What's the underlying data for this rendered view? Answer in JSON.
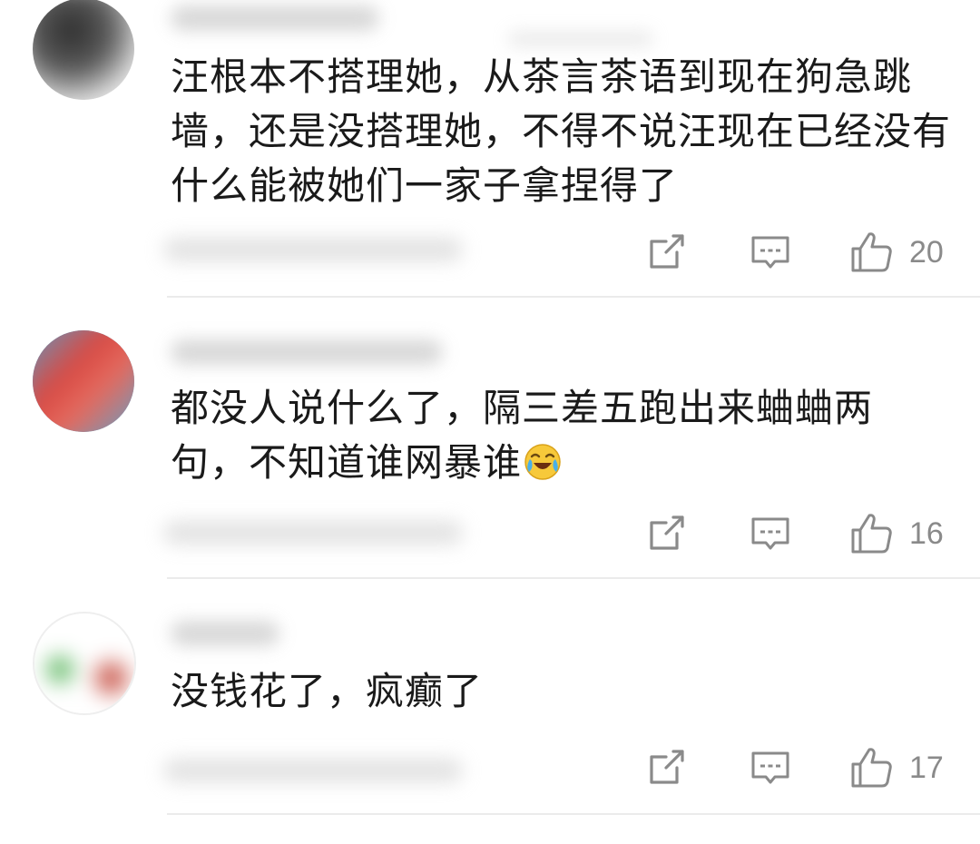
{
  "comments": [
    {
      "text": "汪根本不搭理她，从茶言茶语到现在狗急跳墙，还是没搭理她，不得不说汪现在已经没有什么能被她们一家子拿捏得了",
      "likes": "20",
      "avatar_colors": [
        "#3a3a3a",
        "#f0f0f0"
      ],
      "emoji": ""
    },
    {
      "text": "都没人说什么了，隔三差五跑出来蛐蛐两句，不知道谁网暴谁",
      "likes": "16",
      "avatar_colors": [
        "#d84a44",
        "#4aa8d8"
      ],
      "emoji": "laughing-crying-emoji"
    },
    {
      "text": "没钱花了，疯癫了",
      "likes": "17",
      "avatar_colors": [
        "#ffffff",
        "#c0392b"
      ],
      "emoji": ""
    }
  ],
  "icons": {
    "share": "share-icon",
    "reply": "comment-icon",
    "like": "thumbs-up-icon"
  },
  "colors": {
    "text": "#1a1a1a",
    "icon": "#8a8a8a",
    "divider": "#ebebeb"
  }
}
